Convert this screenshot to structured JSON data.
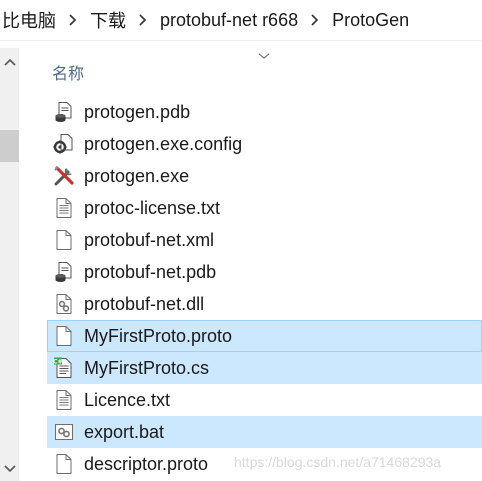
{
  "breadcrumb": {
    "items": [
      "比电脑",
      "下载",
      "protobuf-net r668",
      "ProtoGen"
    ]
  },
  "column_header": {
    "name_label": "名称"
  },
  "files": [
    {
      "name": "protogen.pdb",
      "icon": "pdb-file-icon",
      "selected": false
    },
    {
      "name": "protogen.exe.config",
      "icon": "config-file-icon",
      "selected": false
    },
    {
      "name": "protogen.exe",
      "icon": "exe-tools-icon",
      "selected": false
    },
    {
      "name": "protoc-license.txt",
      "icon": "text-file-icon",
      "selected": false
    },
    {
      "name": "protobuf-net.xml",
      "icon": "blank-file-icon",
      "selected": false
    },
    {
      "name": "protobuf-net.pdb",
      "icon": "pdb-file-icon",
      "selected": false
    },
    {
      "name": "protobuf-net.dll",
      "icon": "dll-file-icon",
      "selected": false
    },
    {
      "name": "MyFirstProto.proto",
      "icon": "blank-file-icon",
      "selected": true
    },
    {
      "name": "MyFirstProto.cs",
      "icon": "csharp-file-icon",
      "selected": true
    },
    {
      "name": "Licence.txt",
      "icon": "text-file-icon",
      "selected": false
    },
    {
      "name": "export.bat",
      "icon": "bat-file-icon",
      "selected": true
    },
    {
      "name": "descriptor.proto",
      "icon": "blank-file-icon",
      "selected": false
    }
  ],
  "watermark": "https://blog.csdn.net/a71468293a",
  "colors": {
    "selection": "#cce8ff",
    "selection_border": "#99d1ff",
    "header_text": "#4d6a8a"
  }
}
